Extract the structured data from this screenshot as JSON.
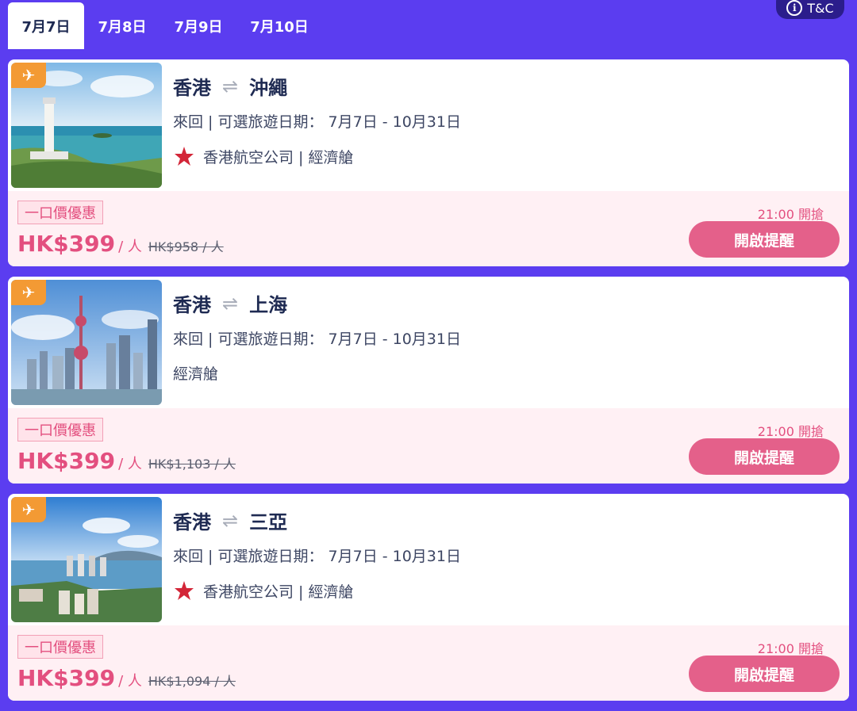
{
  "tabs": [
    {
      "label": "7月7日"
    },
    {
      "label": "7月8日"
    },
    {
      "label": "7月9日"
    },
    {
      "label": "7月10日"
    }
  ],
  "tc_label": "T&C",
  "colors": {
    "background": "#5b3df0",
    "accent": "#e34f7f",
    "button": "#e4608a",
    "tag": "#f39a34"
  },
  "cards": [
    {
      "origin": "香港",
      "destination": "沖繩",
      "dates": "來回 | 可選旅遊日期： 7月7日 - 10月31日",
      "airline": "香港航空公司 | 經濟艙",
      "deal": "一口價優惠",
      "price": "HK$399",
      "per": "/ 人",
      "original": "HK$958 / 人",
      "time": "21:00 開搶",
      "button": "開啟提醒"
    },
    {
      "origin": "香港",
      "destination": "上海",
      "dates": "來回 | 可選旅遊日期： 7月7日 - 10月31日",
      "airline": "經濟艙",
      "deal": "一口價優惠",
      "price": "HK$399",
      "per": "/ 人",
      "original": "HK$1,103 / 人",
      "time": "21:00 開搶",
      "button": "開啟提醒"
    },
    {
      "origin": "香港",
      "destination": "三亞",
      "dates": "來回 | 可選旅遊日期： 7月7日 - 10月31日",
      "airline": "香港航空公司 | 經濟艙",
      "deal": "一口價優惠",
      "price": "HK$399",
      "per": "/ 人",
      "original": "HK$1,094 / 人",
      "time": "21:00 開搶",
      "button": "開啟提醒"
    }
  ]
}
